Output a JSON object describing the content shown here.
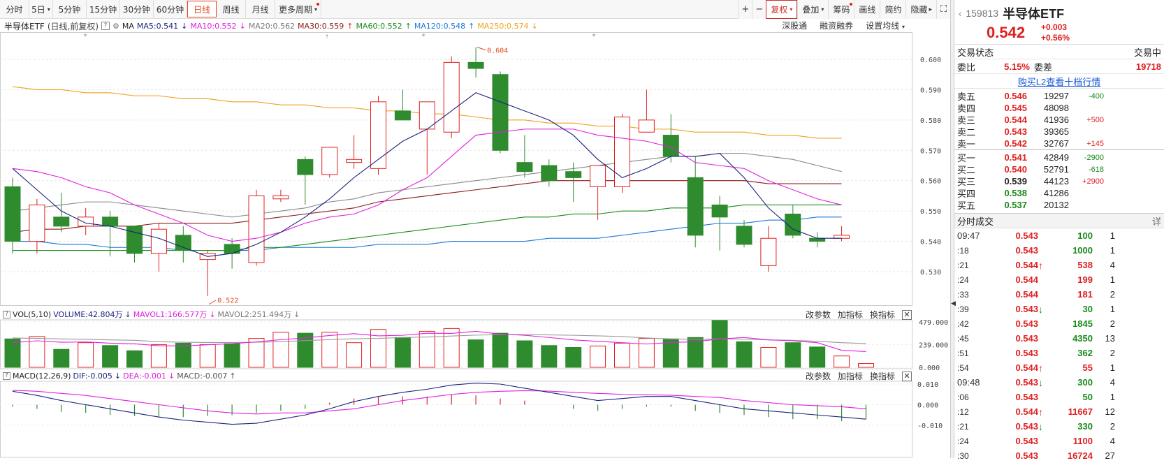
{
  "toolbar": {
    "periods": [
      "分时",
      "5日",
      "5分钟",
      "15分钟",
      "30分钟",
      "60分钟",
      "日线",
      "周线",
      "月线",
      "更多周期"
    ],
    "active_period": "日线",
    "right_buttons": [
      "+",
      "−",
      "复权",
      "叠加",
      "筹码",
      "画线",
      "简约",
      "隐藏"
    ]
  },
  "infobar": {
    "name": "半导体ETF",
    "mode": "(日线,前复权)",
    "ma": "MA",
    "ma5": "MA5:0.541",
    "ma10": "MA10:0.552",
    "ma20": "MA20:0.562",
    "ma30": "MA30:0.559",
    "ma60": "MA60:0.552",
    "ma120": "MA120:0.548",
    "ma250": "MA250:0.574",
    "right": [
      "深股通",
      "融资融券",
      "设置均线"
    ]
  },
  "volume_head": {
    "name": "VOL(5,10)",
    "volume": "VOLUME:42.804万",
    "mavol1": "MAVOL1:166.577万",
    "mavol2": "MAVOL2:251.494万",
    "tools": [
      "改参数",
      "加指标",
      "换指标"
    ]
  },
  "macd_head": {
    "name": "MACD(12,26,9)",
    "dif": "DIF:-0.005",
    "dea": "DEA:-0.001",
    "macd": "MACD:-0.007",
    "tools": [
      "改参数",
      "加指标",
      "换指标"
    ]
  },
  "chart_data": {
    "type": "candlestick",
    "price_axis": [
      "0.600",
      "0.590",
      "0.580",
      "0.570",
      "0.560",
      "0.550",
      "0.540",
      "0.530"
    ],
    "high_label": "0.604",
    "low_label": "0.522",
    "candles": [
      {
        "o": 0.558,
        "h": 0.561,
        "l": 0.536,
        "c": 0.54
      },
      {
        "o": 0.54,
        "h": 0.554,
        "l": 0.536,
        "c": 0.552
      },
      {
        "o": 0.548,
        "h": 0.556,
        "l": 0.543,
        "c": 0.545
      },
      {
        "o": 0.545,
        "h": 0.551,
        "l": 0.542,
        "c": 0.548
      },
      {
        "o": 0.548,
        "h": 0.55,
        "l": 0.535,
        "c": 0.545
      },
      {
        "o": 0.545,
        "h": 0.545,
        "l": 0.533,
        "c": 0.536
      },
      {
        "o": 0.536,
        "h": 0.546,
        "l": 0.53,
        "c": 0.544
      },
      {
        "o": 0.542,
        "h": 0.545,
        "l": 0.533,
        "c": 0.537
      },
      {
        "o": 0.534,
        "h": 0.537,
        "l": 0.522,
        "c": 0.536
      },
      {
        "o": 0.539,
        "h": 0.541,
        "l": 0.531,
        "c": 0.536
      },
      {
        "o": 0.533,
        "h": 0.557,
        "l": 0.532,
        "c": 0.555
      },
      {
        "o": 0.554,
        "h": 0.557,
        "l": 0.553,
        "c": 0.555
      },
      {
        "o": 0.567,
        "h": 0.568,
        "l": 0.552,
        "c": 0.562
      },
      {
        "o": 0.562,
        "h": 0.569,
        "l": 0.561,
        "c": 0.571
      },
      {
        "o": 0.566,
        "h": 0.575,
        "l": 0.564,
        "c": 0.567
      },
      {
        "o": 0.564,
        "h": 0.588,
        "l": 0.562,
        "c": 0.586
      },
      {
        "o": 0.583,
        "h": 0.59,
        "l": 0.58,
        "c": 0.58
      },
      {
        "o": 0.577,
        "h": 0.584,
        "l": 0.562,
        "c": 0.586
      },
      {
        "o": 0.576,
        "h": 0.601,
        "l": 0.574,
        "c": 0.599
      },
      {
        "o": 0.599,
        "h": 0.604,
        "l": 0.594,
        "c": 0.597
      },
      {
        "o": 0.595,
        "h": 0.596,
        "l": 0.569,
        "c": 0.57
      },
      {
        "o": 0.566,
        "h": 0.575,
        "l": 0.561,
        "c": 0.563
      },
      {
        "o": 0.565,
        "h": 0.567,
        "l": 0.558,
        "c": 0.56
      },
      {
        "o": 0.563,
        "h": 0.566,
        "l": 0.553,
        "c": 0.561
      },
      {
        "o": 0.558,
        "h": 0.559,
        "l": 0.547,
        "c": 0.565
      },
      {
        "o": 0.558,
        "h": 0.582,
        "l": 0.556,
        "c": 0.581
      },
      {
        "o": 0.576,
        "h": 0.59,
        "l": 0.576,
        "c": 0.58
      },
      {
        "o": 0.575,
        "h": 0.582,
        "l": 0.566,
        "c": 0.568
      },
      {
        "o": 0.561,
        "h": 0.568,
        "l": 0.538,
        "c": 0.542
      },
      {
        "o": 0.552,
        "h": 0.555,
        "l": 0.537,
        "c": 0.548
      },
      {
        "o": 0.545,
        "h": 0.547,
        "l": 0.538,
        "c": 0.539
      },
      {
        "o": 0.532,
        "h": 0.545,
        "l": 0.53,
        "c": 0.541
      },
      {
        "o": 0.549,
        "h": 0.552,
        "l": 0.541,
        "c": 0.542
      },
      {
        "o": 0.541,
        "h": 0.543,
        "l": 0.538,
        "c": 0.54
      },
      {
        "o": 0.541,
        "h": 0.545,
        "l": 0.54,
        "c": 0.542
      }
    ],
    "ma5": [
      0.564,
      0.557,
      0.55,
      0.546,
      0.545,
      0.543,
      0.541,
      0.538,
      0.535,
      0.536,
      0.539,
      0.543,
      0.548,
      0.554,
      0.561,
      0.567,
      0.573,
      0.577,
      0.583,
      0.589,
      0.586,
      0.583,
      0.58,
      0.575,
      0.567,
      0.561,
      0.564,
      0.568,
      0.568,
      0.569,
      0.561,
      0.551,
      0.544,
      0.541,
      0.541
    ],
    "ma10": [
      0.564,
      0.563,
      0.561,
      0.558,
      0.556,
      0.552,
      0.549,
      0.546,
      0.542,
      0.54,
      0.541,
      0.543,
      0.546,
      0.548,
      0.549,
      0.552,
      0.557,
      0.561,
      0.568,
      0.575,
      0.576,
      0.577,
      0.577,
      0.577,
      0.575,
      0.574,
      0.573,
      0.571,
      0.566,
      0.565,
      0.564,
      0.56,
      0.557,
      0.554,
      0.552
    ],
    "ma20": [
      0.55,
      0.551,
      0.552,
      0.553,
      0.553,
      0.552,
      0.551,
      0.55,
      0.549,
      0.548,
      0.549,
      0.55,
      0.551,
      0.553,
      0.554,
      0.556,
      0.557,
      0.558,
      0.559,
      0.56,
      0.561,
      0.562,
      0.563,
      0.564,
      0.565,
      0.566,
      0.567,
      0.568,
      0.568,
      0.569,
      0.569,
      0.568,
      0.567,
      0.565,
      0.563
    ],
    "ma30": [
      0.543,
      0.544,
      0.544,
      0.545,
      0.545,
      0.545,
      0.546,
      0.546,
      0.546,
      0.546,
      0.547,
      0.548,
      0.549,
      0.55,
      0.551,
      0.553,
      0.554,
      0.555,
      0.556,
      0.557,
      0.558,
      0.559,
      0.56,
      0.56,
      0.56,
      0.56,
      0.56,
      0.56,
      0.56,
      0.56,
      0.56,
      0.559,
      0.559,
      0.559,
      0.559
    ],
    "ma60": [
      0.537,
      0.537,
      0.537,
      0.537,
      0.537,
      0.537,
      0.537,
      0.537,
      0.537,
      0.537,
      0.538,
      0.538,
      0.539,
      0.54,
      0.541,
      0.542,
      0.543,
      0.544,
      0.545,
      0.546,
      0.547,
      0.548,
      0.548,
      0.549,
      0.549,
      0.55,
      0.55,
      0.551,
      0.551,
      0.551,
      0.552,
      0.552,
      0.552,
      0.552,
      0.552
    ],
    "ma120": [
      0.54,
      0.54,
      0.539,
      0.539,
      0.538,
      0.538,
      0.538,
      0.537,
      0.537,
      0.537,
      0.537,
      0.538,
      0.538,
      0.538,
      0.538,
      0.539,
      0.539,
      0.539,
      0.54,
      0.54,
      0.54,
      0.54,
      0.541,
      0.541,
      0.541,
      0.542,
      0.543,
      0.544,
      0.545,
      0.546,
      0.546,
      0.547,
      0.547,
      0.548,
      0.548
    ],
    "ma250": [
      0.591,
      0.59,
      0.59,
      0.589,
      0.589,
      0.588,
      0.588,
      0.587,
      0.587,
      0.586,
      0.586,
      0.585,
      0.585,
      0.584,
      0.584,
      0.583,
      0.583,
      0.582,
      0.582,
      0.581,
      0.58,
      0.58,
      0.579,
      0.579,
      0.578,
      0.578,
      0.577,
      0.577,
      0.576,
      0.576,
      0.576,
      0.575,
      0.575,
      0.574,
      0.574
    ],
    "vol_axis": [
      "479.000",
      "239.000",
      "0.000"
    ],
    "vol_max": 479,
    "volumes": [
      300,
      325,
      190,
      260,
      230,
      175,
      240,
      255,
      240,
      250,
      305,
      370,
      360,
      370,
      260,
      400,
      315,
      380,
      410,
      290,
      360,
      280,
      230,
      210,
      225,
      255,
      305,
      300,
      315,
      495,
      270,
      210,
      260,
      215,
      120,
      40
    ],
    "mavol1": [
      260,
      280,
      265,
      268,
      255,
      248,
      228,
      225,
      238,
      250,
      268,
      292,
      310,
      336,
      355,
      332,
      338,
      360,
      358,
      380,
      350,
      338,
      315,
      290,
      274,
      260,
      246,
      262,
      270,
      300,
      315,
      290,
      280,
      260,
      180,
      166
    ],
    "mavol2": [
      310,
      305,
      300,
      296,
      290,
      285,
      270,
      265,
      262,
      262,
      265,
      270,
      282,
      292,
      302,
      305,
      315,
      320,
      330,
      340,
      345,
      345,
      342,
      338,
      332,
      325,
      310,
      300,
      295,
      300,
      298,
      290,
      285,
      275,
      260,
      251
    ],
    "macd_axis": [
      "0.010",
      "0.000",
      "-0.010"
    ],
    "dif": [
      0.0065,
      0.0045,
      0.002,
      0.0,
      -0.002,
      -0.004,
      -0.006,
      -0.0075,
      -0.0085,
      -0.0095,
      -0.009,
      -0.007,
      -0.005,
      -0.002,
      0.0015,
      0.004,
      0.006,
      0.0075,
      0.0095,
      0.0105,
      0.01,
      0.008,
      0.006,
      0.004,
      0.002,
      0.003,
      0.004,
      0.004,
      0.002,
      0.0,
      -0.002,
      -0.003,
      -0.004,
      -0.005,
      -0.006,
      -0.007
    ],
    "dea": [
      0.007,
      0.0065,
      0.0055,
      0.0045,
      0.003,
      0.0015,
      0.0,
      -0.0015,
      -0.003,
      -0.004,
      -0.0045,
      -0.004,
      -0.004,
      -0.003,
      -0.002,
      0.0,
      0.002,
      0.0035,
      0.005,
      0.006,
      0.0065,
      0.0068,
      0.0066,
      0.006,
      0.0055,
      0.005,
      0.0048,
      0.0046,
      0.004,
      0.0035,
      0.002,
      0.001,
      0.0,
      -0.0005,
      -0.001,
      -0.002
    ],
    "macd": [
      -0.001,
      -0.002,
      -0.0035,
      -0.004,
      -0.005,
      -0.0055,
      -0.006,
      -0.006,
      -0.0055,
      -0.005,
      -0.004,
      -0.003,
      -0.002,
      0.001,
      0.003,
      0.004,
      0.004,
      0.004,
      0.005,
      0.0045,
      0.003,
      0.002,
      0.0,
      -0.002,
      -0.003,
      -0.002,
      -0.001,
      -0.001,
      -0.003,
      -0.004,
      -0.005,
      -0.006,
      -0.007,
      -0.007,
      -0.008,
      -0.007
    ]
  },
  "quote": {
    "code": "159813",
    "name": "半导体ETF",
    "price": "0.542",
    "change": "+0.003",
    "change_pct": "+0.56%",
    "status_label": "交易状态",
    "status_value": "交易中",
    "weibi_label": "委比",
    "weibi_value": "5.15%",
    "weicha_label": "委差",
    "weicha_value": "19718",
    "l2_link": "购买L2查看十档行情"
  },
  "orderbook": {
    "asks": [
      {
        "label": "卖五",
        "price": "0.546",
        "vol": "19297",
        "delta": "-400"
      },
      {
        "label": "卖四",
        "price": "0.545",
        "vol": "48098",
        "delta": ""
      },
      {
        "label": "卖三",
        "price": "0.544",
        "vol": "41936",
        "delta": "+500"
      },
      {
        "label": "卖二",
        "price": "0.543",
        "vol": "39365",
        "delta": ""
      },
      {
        "label": "卖一",
        "price": "0.542",
        "vol": "32767",
        "delta": "+145"
      }
    ],
    "bids": [
      {
        "label": "买一",
        "price": "0.541",
        "vol": "42849",
        "delta": "-2900"
      },
      {
        "label": "买二",
        "price": "0.540",
        "vol": "52791",
        "delta": "-618"
      },
      {
        "label": "买三",
        "price": "0.539",
        "vol": "44123",
        "delta": "+2900"
      },
      {
        "label": "买四",
        "price": "0.538",
        "vol": "41286",
        "delta": ""
      },
      {
        "label": "买五",
        "price": "0.537",
        "vol": "20132",
        "delta": ""
      }
    ]
  },
  "ticks": {
    "title": "分时成交",
    "detail": "详",
    "rows": [
      {
        "t": "09:47",
        "p": "0.543",
        "ar": "",
        "v": "100",
        "n": "1",
        "vc": "green"
      },
      {
        "t": ":18",
        "p": "0.543",
        "ar": "",
        "v": "1000",
        "n": "1",
        "vc": "green"
      },
      {
        "t": ":21",
        "p": "0.544",
        "ar": "↑",
        "v": "538",
        "n": "4",
        "vc": "red"
      },
      {
        "t": ":24",
        "p": "0.544",
        "ar": "",
        "v": "199",
        "n": "1",
        "vc": "red"
      },
      {
        "t": ":33",
        "p": "0.544",
        "ar": "",
        "v": "181",
        "n": "2",
        "vc": "red"
      },
      {
        "t": ":39",
        "p": "0.543",
        "ar": "↓",
        "v": "30",
        "n": "1",
        "vc": "green"
      },
      {
        "t": ":42",
        "p": "0.543",
        "ar": "",
        "v": "1845",
        "n": "2",
        "vc": "green"
      },
      {
        "t": ":45",
        "p": "0.543",
        "ar": "",
        "v": "4350",
        "n": "13",
        "vc": "green"
      },
      {
        "t": ":51",
        "p": "0.543",
        "ar": "",
        "v": "362",
        "n": "2",
        "vc": "green"
      },
      {
        "t": ":54",
        "p": "0.544",
        "ar": "↑",
        "v": "55",
        "n": "1",
        "vc": "red"
      },
      {
        "t": "09:48",
        "p": "0.543",
        "ar": "↓",
        "v": "300",
        "n": "4",
        "vc": "green"
      },
      {
        "t": ":06",
        "p": "0.543",
        "ar": "",
        "v": "50",
        "n": "1",
        "vc": "green"
      },
      {
        "t": ":12",
        "p": "0.544",
        "ar": "↑",
        "v": "11667",
        "n": "12",
        "vc": "red"
      },
      {
        "t": ":21",
        "p": "0.543",
        "ar": "↓",
        "v": "330",
        "n": "2",
        "vc": "green"
      },
      {
        "t": ":24",
        "p": "0.543",
        "ar": "",
        "v": "1100",
        "n": "4",
        "vc": "red"
      },
      {
        "t": ":30",
        "p": "0.543",
        "ar": "",
        "v": "16724",
        "n": "27",
        "vc": "red"
      }
    ]
  },
  "colors": {
    "up": "#e02020",
    "down": "#2e8b2e",
    "ma5": "#1a237e",
    "ma10": "#e020e0",
    "ma20": "#888888",
    "ma30": "#8b1a1a",
    "ma60": "#1a8a1a",
    "ma120": "#1a7ad8",
    "ma250": "#f0a020"
  }
}
